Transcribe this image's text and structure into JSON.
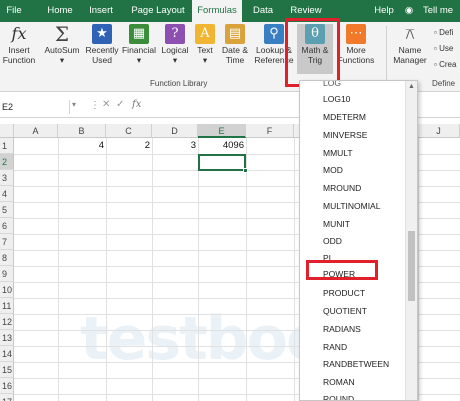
{
  "tabs": [
    "File",
    "Home",
    "Insert",
    "Page Layout",
    "Formulas",
    "Data",
    "Review",
    "Help",
    "Tell me"
  ],
  "ribbon": {
    "insert_function": [
      "Insert",
      "Function"
    ],
    "autosum": "AutoSum",
    "recently_used": [
      "Recently",
      "Used"
    ],
    "financial": "Financial",
    "logical": "Logical",
    "text": "Text",
    "date_time": [
      "Date &",
      "Time"
    ],
    "lookup": [
      "Lookup &",
      "Reference"
    ],
    "math_trig": [
      "Math &",
      "Trig"
    ],
    "more_functions": [
      "More",
      "Functions"
    ],
    "name_manager": [
      "Name",
      "Manager"
    ],
    "group_label": "Function Library",
    "defined_names_items": [
      "Defi",
      "Use",
      "Crea"
    ],
    "defined_names_label": "Define"
  },
  "formula_bar": {
    "name_box": "E2"
  },
  "columns": [
    "A",
    "B",
    "C",
    "D",
    "E",
    "F"
  ],
  "extra_col": "J",
  "rows": [
    "1",
    "2",
    "3",
    "4",
    "5",
    "6",
    "7",
    "8",
    "9",
    "10",
    "11",
    "12",
    "13",
    "14",
    "15",
    "16",
    "17"
  ],
  "cells": {
    "B1": "4",
    "C1": "2",
    "D1": "3",
    "E1": "4096"
  },
  "dropdown_items": [
    "LOG10",
    "MDETERM",
    "MINVERSE",
    "MMULT",
    "MOD",
    "MROUND",
    "MULTINOMIAL",
    "MUNIT",
    "ODD",
    "PI",
    "POWER",
    "PRODUCT",
    "QUOTIENT",
    "RADIANS",
    "RAND",
    "RANDBETWEEN",
    "ROMAN",
    "ROUND"
  ],
  "dropdown_top_partial": "LOG",
  "watermark": "testbook",
  "colors": {
    "accent": "#217346",
    "highlight": "#e0202a"
  }
}
